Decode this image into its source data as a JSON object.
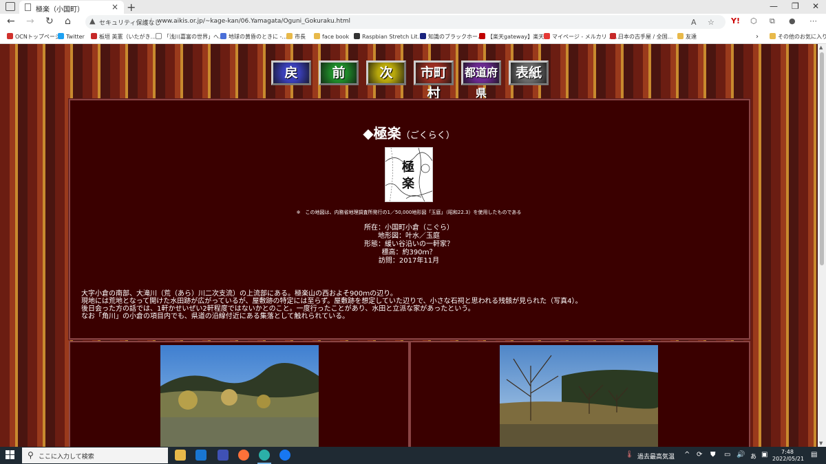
{
  "browser": {
    "tab_title": "極楽（小国町）",
    "security_label": "セキュリティ保護なし",
    "url": "www.aikis.or.jp/~kage-kan/06.Yamagata/Oguni_Gokuraku.html",
    "reader_label": "A",
    "yahoo_label": "Y!"
  },
  "bookmarks": [
    {
      "label": "OCNトップページ",
      "icon_color": "#d0312d"
    },
    {
      "label": "Twitter",
      "icon_color": "#1da1f2"
    },
    {
      "label": "板垣 英憲（いたがき...",
      "icon_color": "#c62828"
    },
    {
      "label": "「浅川嘉富の世界」へ...",
      "icon_color": "#ffffff"
    },
    {
      "label": "地球の黄昏のときに -...",
      "icon_color": "#4a6fd8"
    },
    {
      "label": "市長",
      "icon_color": "#e8b94a"
    },
    {
      "label": "face book",
      "icon_color": "#e8b94a"
    },
    {
      "label": "Raspbian Stretch Lit...",
      "icon_color": "#333333"
    },
    {
      "label": "知識のブラックホール",
      "icon_color": "#1a237e"
    },
    {
      "label": "【楽天gateway】楽天...",
      "icon_color": "#bf0000"
    },
    {
      "label": "マイページ - メルカリ ス...",
      "icon_color": "#e53935"
    },
    {
      "label": "日本の古手屋 / 全国...",
      "icon_color": "#c62828"
    },
    {
      "label": "友達",
      "icon_color": "#e8b94a"
    },
    {
      "label": "その他のお気に入り",
      "icon_color": "#e8b94a"
    }
  ],
  "nav_buttons": [
    {
      "label": "戻",
      "color": "#3a3fb8"
    },
    {
      "label": "前",
      "color": "#1f8a2a"
    },
    {
      "label": "次",
      "color": "#b8a80c"
    },
    {
      "label": "市町村",
      "color": "#9b2f22"
    },
    {
      "label": "都道府県",
      "color": "#6b2a90"
    },
    {
      "label": "表紙",
      "color": "#6a6a6a"
    }
  ],
  "page": {
    "title": "◆極楽",
    "title_yomi": "（ごくらく）",
    "map_chars": [
      "極",
      "楽"
    ],
    "map_note": "※　この地図は、内務省地理調査所発行の1／50,000地形図「玉庭」（昭和22.3）を使用したものである",
    "info": [
      "所在：小国町小倉（こぐら）",
      "地形図：叶水／玉庭",
      "形態：緩い谷沿いの一軒家？",
      "標高：約390ｍ？",
      "訪問：2017年11月"
    ],
    "body": [
      "大字小倉の南部、大滝川（荒（あら）川二次支流）の上流部にある。極楽山の西およそ900ｍの辺り。",
      "現地には荒地となって開けた水田跡が広がっているが、屋敷跡の特定には至らず。屋敷跡を想定していた辺りで、小さな石祠と思われる残骸が見られた（写真4）。",
      "後日会った方の話では、1軒かせいぜい2軒程度ではないかとのこと。一度行ったことがあり、水田と立派な家があったという。",
      "なお「角川」の小倉の項目内でも、県道の沿線付近にある集落として触れられている。"
    ]
  },
  "taskbar": {
    "search_placeholder": "ここに入力して検索",
    "weather": "過去最高気温",
    "ime": "あ",
    "time": "7:48",
    "date": "2022/05/21"
  }
}
